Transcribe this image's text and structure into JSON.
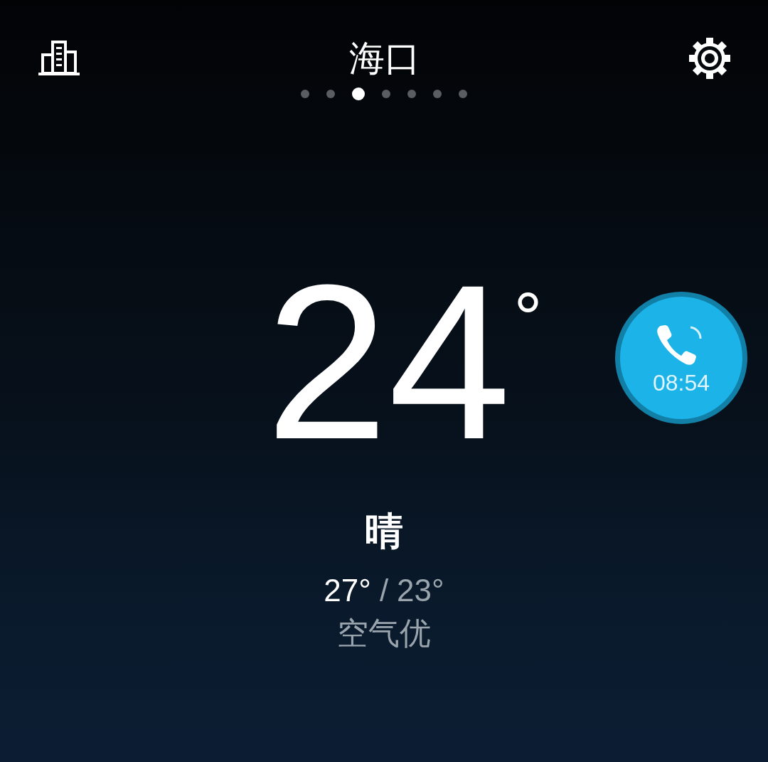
{
  "header": {
    "city": "海口"
  },
  "pages": [
    {
      "selected": false
    },
    {
      "selected": false
    },
    {
      "selected": true
    },
    {
      "selected": false
    },
    {
      "selected": false
    },
    {
      "selected": false
    },
    {
      "selected": false
    }
  ],
  "current": {
    "temperature": "24",
    "degree": "°",
    "condition": "晴",
    "high": "27°",
    "separator": "/",
    "low": "23°",
    "air_quality": "空气优"
  },
  "call_bubble": {
    "duration": "08:54"
  }
}
